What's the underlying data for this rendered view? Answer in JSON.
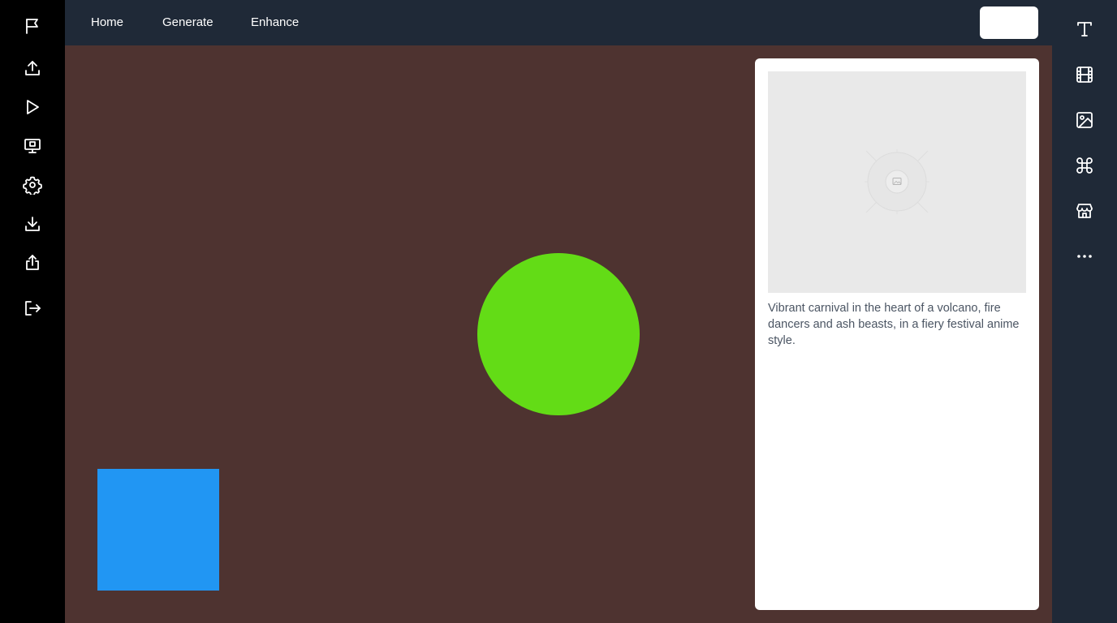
{
  "nav": {
    "home": "Home",
    "generate": "Generate",
    "enhance": "Enhance",
    "action_button_label": ""
  },
  "left_rail_icons": [
    "flag-icon",
    "upload-icon",
    "play-icon",
    "presentation-icon",
    "gear-icon",
    "download-icon",
    "share-icon",
    "logout-icon"
  ],
  "right_rail_icons": [
    "text-icon",
    "film-icon",
    "image-icon",
    "command-icon",
    "store-icon",
    "more-icon"
  ],
  "canvas": {
    "background": "#4e3330",
    "circle_color": "#63dc16",
    "square_color": "#2196f3"
  },
  "panel": {
    "image_placeholder_icon": "image-icon",
    "caption": "Vibrant carnival in the heart of a volcano, fire dancers and ash beasts, in a fiery festival anime style."
  },
  "colors": {
    "left_rail": "#000000",
    "topbar": "#1f2937",
    "right_rail": "#1f2937"
  }
}
